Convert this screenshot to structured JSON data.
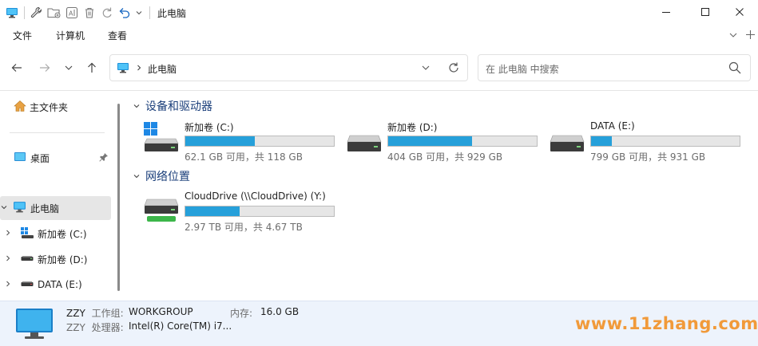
{
  "window": {
    "title": "此电脑",
    "controls": [
      "minimize-icon",
      "maximize-icon",
      "close-icon"
    ]
  },
  "quick_access_toolbar": [
    "computer-icon",
    "properties-wrench-icon",
    "new-folder-icon",
    "rename-icon",
    "delete-icon",
    "redo-icon",
    "undo-icon",
    "chevron-down-icon"
  ],
  "menu": {
    "items": [
      "文件",
      "计算机",
      "查看"
    ]
  },
  "nav": {
    "address_text": "此电脑",
    "search_placeholder": "在 此电脑 中搜索"
  },
  "sidebar": {
    "items": [
      {
        "label": "主文件夹",
        "icon": "home-icon"
      },
      {
        "label": "桌面",
        "icon": "desktop-icon",
        "pinned": true
      },
      {
        "label": "此电脑",
        "icon": "computer-icon",
        "selected": true
      },
      {
        "label": "新加卷 (C:)",
        "icon": "windows-drive-icon"
      },
      {
        "label": "新加卷 (D:)",
        "icon": "drive-icon"
      },
      {
        "label": "DATA (E:)",
        "icon": "drive-icon"
      }
    ]
  },
  "sections": {
    "devices_title": "设备和驱动器",
    "network_title": "网络位置"
  },
  "drives": [
    {
      "name": "新加卷 (C:)",
      "free_text": "62.1 GB 可用，共 118 GB",
      "used_fraction": 0.47,
      "icon": "windows-drive-icon"
    },
    {
      "name": "新加卷 (D:)",
      "free_text": "404 GB 可用，共 929 GB",
      "used_fraction": 0.565,
      "icon": "drive-icon"
    },
    {
      "name": "DATA (E:)",
      "free_text": "799 GB 可用，共 931 GB",
      "used_fraction": 0.142,
      "icon": "drive-icon"
    }
  ],
  "network": [
    {
      "name": "CloudDrive (\\\\CloudDrive) (Y:)",
      "free_text": "2.97 TB 可用，共 4.67 TB",
      "used_fraction": 0.364,
      "icon": "network-drive-icon"
    }
  ],
  "status": {
    "computer_name": "ZZY",
    "workgroup_label": "工作组:",
    "workgroup_value": "WORKGROUP",
    "memory_label": "内存:",
    "memory_value": "16.0 GB",
    "processor_label": "处理器:",
    "processor_value": "Intel(R) Core(TM) i7...",
    "computer_name_2": "ZZY"
  },
  "watermark": "www.11zhang.com",
  "colors": {
    "accent": "#26a0da",
    "section_title": "#1a3e7a",
    "statusbar_bg": "#edf3fc",
    "watermark": "#f19a3a"
  }
}
